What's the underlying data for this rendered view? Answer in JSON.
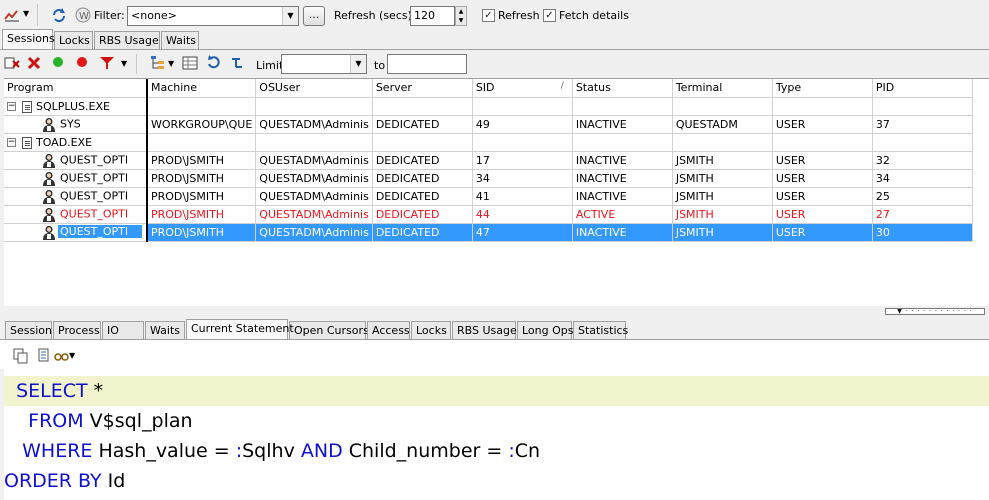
{
  "toolbar": {
    "filter_label": "Filter:",
    "filter_value": "<none>",
    "dots_label": "...",
    "refresh_secs_label": "Refresh (secs)",
    "refresh_secs_value": "120",
    "refresh_checkbox_label": "Refresh",
    "refresh_checked": true,
    "fetch_details_label": "Fetch details",
    "fetch_details_checked": true
  },
  "top_tabs": [
    {
      "label": "Sessions",
      "active": true
    },
    {
      "label": "Locks",
      "active": false
    },
    {
      "label": "RBS Usage",
      "active": false
    },
    {
      "label": "Waits",
      "active": false
    }
  ],
  "toolbar2": {
    "limit_label": "Limit",
    "limit_value": "",
    "to_label": "to",
    "to_value": ""
  },
  "grid": {
    "columns": [
      "Program",
      "Machine",
      "OSUser",
      "Server",
      "SID",
      "Status",
      "Terminal",
      "Type",
      "PID"
    ],
    "sort_indicator": "/",
    "groups": [
      {
        "program": "SQLPLUS.EXE",
        "rows": [
          {
            "program": "SYS",
            "machine": "WORKGROUP\\QUE",
            "osuser": "QUESTADM\\Adminis",
            "server": "DEDICATED",
            "sid": "49",
            "status": "INACTIVE",
            "terminal": "QUESTADM",
            "type": "USER",
            "pid": "37",
            "state": "normal"
          }
        ]
      },
      {
        "program": "TOAD.EXE",
        "rows": [
          {
            "program": "QUEST_OPTI",
            "machine": "PROD\\JSMITH",
            "osuser": "QUESTADM\\Adminis",
            "server": "DEDICATED",
            "sid": "17",
            "status": "INACTIVE",
            "terminal": "JSMITH",
            "type": "USER",
            "pid": "32",
            "state": "normal"
          },
          {
            "program": "QUEST_OPTI",
            "machine": "PROD\\JSMITH",
            "osuser": "QUESTADM\\Adminis",
            "server": "DEDICATED",
            "sid": "34",
            "status": "INACTIVE",
            "terminal": "JSMITH",
            "type": "USER",
            "pid": "34",
            "state": "normal"
          },
          {
            "program": "QUEST_OPTI",
            "machine": "PROD\\JSMITH",
            "osuser": "QUESTADM\\Adminis",
            "server": "DEDICATED",
            "sid": "41",
            "status": "INACTIVE",
            "terminal": "JSMITH",
            "type": "USER",
            "pid": "25",
            "state": "normal"
          },
          {
            "program": "QUEST_OPTI",
            "machine": "PROD\\JSMITH",
            "osuser": "QUESTADM\\Adminis",
            "server": "DEDICATED",
            "sid": "44",
            "status": "ACTIVE",
            "terminal": "JSMITH",
            "type": "USER",
            "pid": "27",
            "state": "active"
          },
          {
            "program": "QUEST_OPTI",
            "machine": "PROD\\JSMITH",
            "osuser": "QUESTADM\\Adminis",
            "server": "DEDICATED",
            "sid": "47",
            "status": "INACTIVE",
            "terminal": "JSMITH",
            "type": "USER",
            "pid": "30",
            "state": "selected"
          }
        ]
      }
    ]
  },
  "detail_tabs": [
    {
      "label": "Session",
      "active": false
    },
    {
      "label": "Process",
      "active": false
    },
    {
      "label": "IO",
      "active": false
    },
    {
      "label": "Waits",
      "active": false
    },
    {
      "label": "Current Statement",
      "active": true
    },
    {
      "label": "Open Cursors",
      "active": false
    },
    {
      "label": "Access",
      "active": false
    },
    {
      "label": "Locks",
      "active": false
    },
    {
      "label": "RBS Usage",
      "active": false
    },
    {
      "label": "Long Ops",
      "active": false
    },
    {
      "label": "Statistics",
      "active": false
    }
  ],
  "sql": {
    "lines": [
      {
        "parts": [
          {
            "t": "  SELECT",
            "k": true
          },
          {
            "t": " *",
            "k": false
          }
        ],
        "highlight": true
      },
      {
        "parts": [
          {
            "t": "    FROM",
            "k": true
          },
          {
            "t": " V$sql_plan",
            "k": false
          }
        ],
        "highlight": false
      },
      {
        "parts": [
          {
            "t": "   WHERE",
            "k": true
          },
          {
            "t": " Hash_value = ",
            "k": false
          },
          {
            "t": ":",
            "k": true
          },
          {
            "t": "Sqlhv ",
            "k": false
          },
          {
            "t": "AND",
            "k": true
          },
          {
            "t": " Child_number = ",
            "k": false
          },
          {
            "t": ":",
            "k": true
          },
          {
            "t": "Cn",
            "k": false
          }
        ],
        "highlight": false
      },
      {
        "parts": [
          {
            "t": "ORDER BY",
            "k": true
          },
          {
            "t": " Id",
            "k": false
          }
        ],
        "highlight": false
      }
    ]
  },
  "colors": {
    "active_row": "#e8141b",
    "selected_row": "#3399ff",
    "keyword": "#1010d4",
    "current_line": "#f1f4cc"
  }
}
